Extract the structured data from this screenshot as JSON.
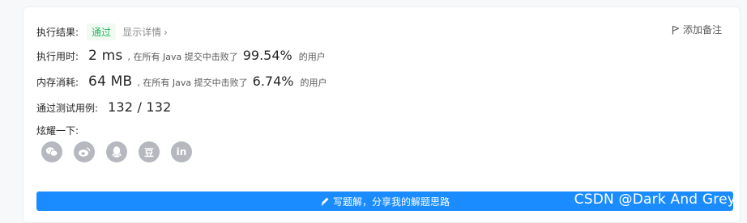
{
  "result": {
    "label": "执行结果:",
    "status": "通过",
    "detail_link": "显示详情",
    "detail_chevron": "›",
    "note_icon": "flag-icon",
    "note_label": "添加备注"
  },
  "runtime": {
    "label": "执行用时:",
    "value": "2 ms",
    "prefix": ", 在所有 Java 提交中击败了",
    "percent": "99.54%",
    "suffix": "的用户"
  },
  "memory": {
    "label": "内存消耗:",
    "value": "64 MB",
    "prefix": ", 在所有 Java 提交中击败了",
    "percent": "6.74%",
    "suffix": "的用户"
  },
  "tests": {
    "label": "通过测试用例:",
    "value": "132 / 132"
  },
  "share": {
    "label": "炫耀一下:",
    "icons": [
      "wechat-icon",
      "weibo-icon",
      "qq-icon",
      "douban-icon",
      "linkedin-icon"
    ],
    "douban_glyph": "豆",
    "linkedin_glyph": "in"
  },
  "solution_button": {
    "icon": "pencil-icon",
    "label": "写题解，分享我的解题思路"
  },
  "watermark": "CSDN @Dark And Grey",
  "colors": {
    "accent": "#1a8cff",
    "pass_green": "#2db55d",
    "icon_gray": "#b5b8bf"
  }
}
